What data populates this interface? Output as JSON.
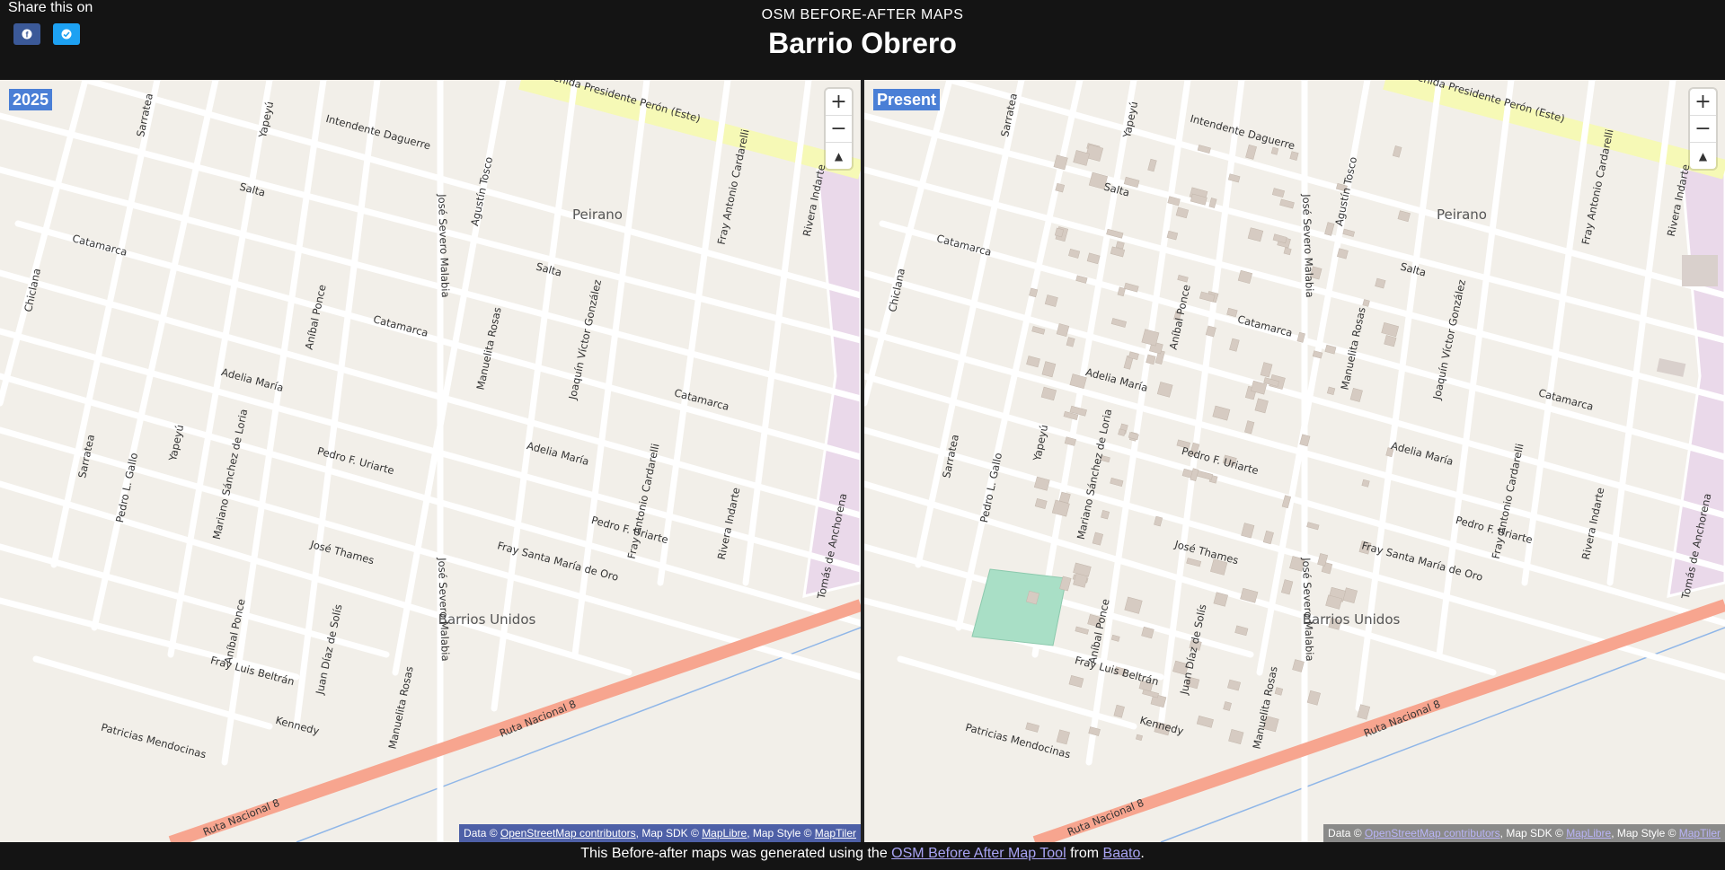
{
  "share": {
    "label": "Share this on",
    "buttons": [
      {
        "name": "facebook",
        "icon": "facebook-icon",
        "color": "#3b5998"
      },
      {
        "name": "twitter",
        "icon": "twitter-icon",
        "color": "#1da1f2"
      }
    ]
  },
  "header": {
    "kicker": "OSM BEFORE-AFTER MAPS",
    "title": "Barrio Obrero"
  },
  "maps": {
    "left": {
      "badge": "2025"
    },
    "right": {
      "badge": "Present"
    },
    "zoom": {
      "in": "+",
      "out": "−",
      "compass": "▲"
    },
    "attribution": {
      "data_prefix": "Data © ",
      "osm": "OpenStreetMap contributors",
      "sdk_prefix": ", Map SDK © ",
      "maplibre": "MapLibre",
      "style_prefix": ", Map Style © ",
      "maptiler": "MapTiler"
    },
    "neighborhoods": [
      "Peirano",
      "Barrios Unidos"
    ],
    "streets": {
      "avenida": "Avenida Presidente Perón (Este)",
      "intendente": "Intendente Daguerre",
      "salta": "Salta",
      "catamarca": "Catamarca",
      "adelia": "Adelia María",
      "pedro": "Pedro F. Uriarte",
      "jose_thames": "José Thames",
      "fray_santa": "Fray Santa María de Oro",
      "fray_luis": "Fray Luis Beltrán",
      "kennedy": "Kennedy",
      "patricias": "Patricias Mendocinas",
      "ruta": "Ruta Nacional 8",
      "sarratea": "Sarratea",
      "yapeyu": "Yapeyú",
      "chiclana": "Chiclana",
      "anibal": "Aníbal Ponce",
      "jose_severo": "José Severo Malabia",
      "agustin": "Agustín Tosco",
      "manuelita": "Manuelita Rosas",
      "joaquin": "Joaquín Víctor González",
      "fray_antonio": "Fray Antonio Cardarelli",
      "rivera": "Rivera Indarte",
      "tomas": "Tomás de Anchorena",
      "pedro_gallo": "Pedro L. Gallo",
      "mariano": "Mariano Sánchez de Loria",
      "juan_diaz": "Juan Díaz de Solís"
    },
    "colors": {
      "land": "#f2efe9",
      "road": "#ffffff",
      "trunk": "#f7a58f",
      "primary": "#f6f9b6",
      "institutional": "#ead9ea",
      "park": "#a9dfc6",
      "building": "#d6cbc2",
      "rail": "#8fb6e8"
    }
  },
  "footer": {
    "prefix": "This Before-after maps was generated using the ",
    "tool": "OSM Before After Map Tool",
    "middle": " from ",
    "org": "Baato",
    "suffix": "."
  }
}
